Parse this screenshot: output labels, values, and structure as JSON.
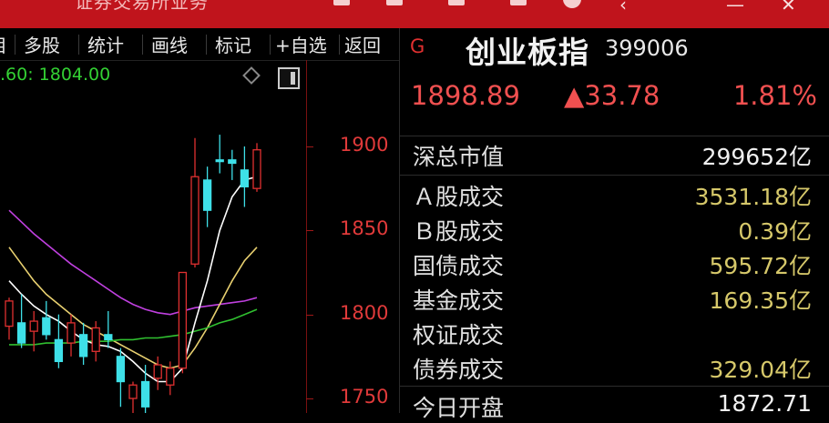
{
  "titlebar": {
    "title": "证券交易所业务"
  },
  "toolbar": {
    "items": [
      "目",
      "多股",
      "统计",
      "画线",
      "标记",
      "+自选",
      "返回"
    ]
  },
  "chart": {
    "ma_readout": ".60: 1804.00",
    "colors": {
      "up": "#e03030",
      "down": "#3ee0e8",
      "ma5": "#ffffff",
      "ma10": "#e8d070",
      "ma20": "#c040e0",
      "ma60": "#30c030"
    }
  },
  "chart_data": {
    "type": "candlestick",
    "y_ticks": [
      "1900",
      "1850",
      "1800",
      "1750"
    ],
    "ylim": [
      1735,
      1925
    ],
    "candles": [
      {
        "o": 1793,
        "h": 1810,
        "l": 1785,
        "c": 1808
      },
      {
        "o": 1795,
        "h": 1812,
        "l": 1780,
        "c": 1783
      },
      {
        "o": 1790,
        "h": 1802,
        "l": 1778,
        "c": 1796
      },
      {
        "o": 1798,
        "h": 1808,
        "l": 1785,
        "c": 1788
      },
      {
        "o": 1785,
        "h": 1800,
        "l": 1768,
        "c": 1772
      },
      {
        "o": 1783,
        "h": 1800,
        "l": 1775,
        "c": 1795
      },
      {
        "o": 1788,
        "h": 1795,
        "l": 1770,
        "c": 1775
      },
      {
        "o": 1778,
        "h": 1796,
        "l": 1772,
        "c": 1792
      },
      {
        "o": 1788,
        "h": 1802,
        "l": 1780,
        "c": 1785
      },
      {
        "o": 1775,
        "h": 1780,
        "l": 1745,
        "c": 1760
      },
      {
        "o": 1750,
        "h": 1760,
        "l": 1735,
        "c": 1758
      },
      {
        "o": 1760,
        "h": 1770,
        "l": 1740,
        "c": 1745
      },
      {
        "o": 1762,
        "h": 1775,
        "l": 1755,
        "c": 1770
      },
      {
        "o": 1758,
        "h": 1772,
        "l": 1752,
        "c": 1768
      },
      {
        "o": 1768,
        "h": 1800,
        "l": 1765,
        "c": 1825
      },
      {
        "o": 1830,
        "h": 1905,
        "l": 1828,
        "c": 1882
      },
      {
        "o": 1880,
        "h": 1888,
        "l": 1852,
        "c": 1862
      },
      {
        "o": 1892,
        "h": 1907,
        "l": 1884,
        "c": 1891
      },
      {
        "o": 1892,
        "h": 1898,
        "l": 1880,
        "c": 1890
      },
      {
        "o": 1886,
        "h": 1900,
        "l": 1864,
        "c": 1876
      },
      {
        "o": 1875,
        "h": 1902,
        "l": 1873,
        "c": 1898
      }
    ],
    "ma": {
      "ma5": [
        1820,
        1812,
        1805,
        1800,
        1796,
        1790,
        1785,
        1782,
        1781,
        1778,
        1772,
        1765,
        1760,
        1760,
        1768,
        1795,
        1820,
        1850,
        1870,
        1880,
        1882
      ],
      "ma10": [
        1840,
        1830,
        1820,
        1812,
        1806,
        1800,
        1794,
        1790,
        1786,
        1782,
        1778,
        1774,
        1770,
        1768,
        1770,
        1780,
        1792,
        1806,
        1820,
        1832,
        1840
      ],
      "ma20": [
        1862,
        1855,
        1848,
        1842,
        1836,
        1830,
        1825,
        1820,
        1815,
        1810,
        1806,
        1803,
        1801,
        1800,
        1802,
        1804,
        1805,
        1806,
        1807,
        1808,
        1810
      ],
      "ma60": [
        1782,
        1782,
        1782,
        1783,
        1783,
        1783,
        1784,
        1784,
        1784,
        1785,
        1785,
        1786,
        1786,
        1787,
        1788,
        1790,
        1792,
        1795,
        1797,
        1800,
        1803
      ]
    }
  },
  "panel": {
    "badge": "G",
    "index_name": "创业板指",
    "index_code": "399006",
    "last_price": "1898.89",
    "change": "▲33.78",
    "change_pct": "1.81%",
    "rows": [
      {
        "label": "深总市值",
        "value": "299652亿"
      },
      {
        "label": "Ａ股成交",
        "value": "3531.18亿"
      },
      {
        "label": "Ｂ股成交",
        "value": "0.39亿"
      },
      {
        "label": "国债成交",
        "value": "595.72亿"
      },
      {
        "label": "基金成交",
        "value": "169.35亿"
      },
      {
        "label": "权证成交",
        "value": ""
      },
      {
        "label": "债券成交",
        "value": "329.04亿"
      },
      {
        "label": "今日开盘",
        "value": "1872.71"
      }
    ]
  }
}
